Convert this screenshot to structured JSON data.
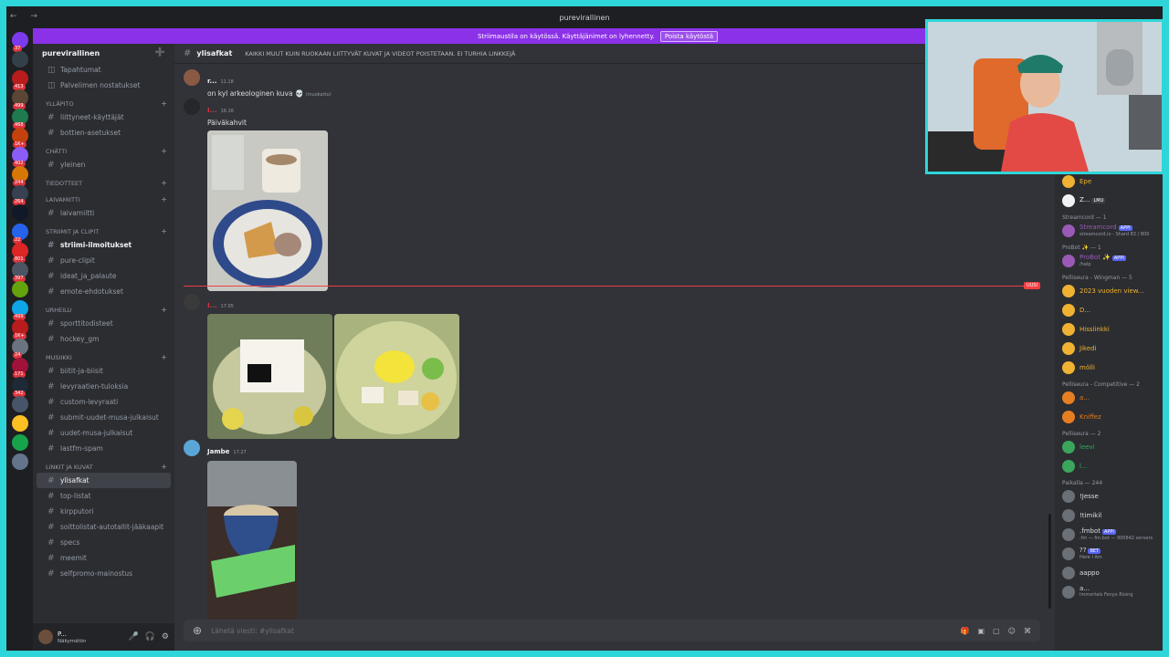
{
  "window": {
    "title": "purevirallinen",
    "nav": "← →"
  },
  "servers": [
    {
      "color": "#7c3aed",
      "badge": "37"
    },
    {
      "color": "#33404a",
      "badge": ""
    },
    {
      "color": "#b91c1c",
      "badge": "413"
    },
    {
      "color": "#5b4636",
      "badge": "499"
    },
    {
      "color": "#1f7a4d",
      "badge": "468"
    },
    {
      "color": "#c2410c",
      "badge": "1K+"
    },
    {
      "color": "#8b5cf6",
      "badge": "402"
    },
    {
      "color": "#d97706",
      "badge": "244"
    },
    {
      "color": "#374151",
      "badge": "264"
    },
    {
      "color": "#111827",
      "badge": ""
    },
    {
      "color": "#2563eb",
      "badge": "22"
    },
    {
      "color": "#dc2626",
      "badge": "801"
    },
    {
      "color": "#4b5563",
      "badge": "397"
    },
    {
      "color": "#65a30d",
      "badge": ""
    },
    {
      "color": "#0ea5e9",
      "badge": "499"
    },
    {
      "color": "#b91c1c",
      "badge": "1K+"
    },
    {
      "color": "#6b7280",
      "badge": "24"
    },
    {
      "color": "#9f1239",
      "badge": "171"
    },
    {
      "color": "#1f2937",
      "badge": "342"
    },
    {
      "color": "#475569",
      "badge": ""
    },
    {
      "color": "#fbbf24",
      "badge": ""
    },
    {
      "color": "#16a34a",
      "badge": ""
    },
    {
      "color": "#64748b",
      "badge": ""
    }
  ],
  "banner": {
    "text": "Striimaustila on käytössä. Käyttäjänimet on lyhennetty.",
    "button": "Poista käytöstä"
  },
  "sidebar": {
    "server_name": "purevirallinen",
    "top_items": [
      {
        "label": "Tapahtumat"
      },
      {
        "label": "Palvelimen nostatukset"
      }
    ],
    "categories": [
      {
        "name": "YLLÄPITO",
        "channels": [
          "liittyneet-käyttäjät",
          "bottien-asetukset"
        ]
      },
      {
        "name": "CHÄTTI",
        "channels": [
          "yleinen"
        ]
      },
      {
        "name": "TIEDOTTEET",
        "channels": []
      },
      {
        "name": "LAIVAMIITTI",
        "channels": [
          "laivamiitti"
        ]
      },
      {
        "name": "STRIIMIT JA CLIPIT",
        "channels": [
          "striimi-ilmoitukset",
          "pure-clipit",
          "ideat_ja_palaute",
          "emote-ehdotukset"
        ]
      },
      {
        "name": "urheilu",
        "channels": [
          "sporttitodisteet",
          "hockey_gm"
        ]
      },
      {
        "name": "MUSIIKKI",
        "channels": [
          "biitit-ja-biisit",
          "levyraatien-tuloksia",
          "custom-levyraati",
          "submit-uudet-musa-julkaisut",
          "uudet-musa-julkaisut",
          "lastfm-spam"
        ]
      },
      {
        "name": "LINKIT JA KUVAT",
        "channels": [
          "ylisafkat",
          "top-listat",
          "kirpputori",
          "soittolistat-autotallit-jääkaapit",
          "specs",
          "meemit",
          "selfpromo-mainostus"
        ]
      }
    ],
    "active_channel": "ylisafkat",
    "unread_channel": "striimi-ilmoitukset",
    "user": {
      "name": "P...",
      "status": "Näkymätön"
    }
  },
  "channel": {
    "name": "ylisafkat",
    "topic": "KAIKKI MUUT KUIN RUOKAAN LIITTYVÄT KUVAT JA VIDEOT POISTETAAN. EI TURHIA LINKKEJÄ",
    "composer_placeholder": "Lähetä viesti: #ylisafkat"
  },
  "messages": [
    {
      "author": "r...",
      "time": "11.18",
      "text": "on kyl arkeologinen kuva 💀",
      "edited": "(muokattu)",
      "avatar": "#8a5a44"
    },
    {
      "author": "I...",
      "time": "16.16",
      "text": "Päiväkahvit",
      "avatar": "#2b2d31"
    },
    {
      "author": "I...",
      "time": "17.05",
      "text": "",
      "avatar": "#3a3a3a"
    },
    {
      "author": "Jambe",
      "time": "17.27",
      "text": "",
      "avatar": "#5aa6d6"
    }
  ],
  "new_divider": "UUSI",
  "members": {
    "top": [
      {
        "name": "Epe",
        "color": "#f0b232"
      },
      {
        "name": "Z...",
        "color": "#f2f3f5",
        "extra": "LMU"
      }
    ],
    "groups": [
      {
        "title": "Streamcord — 1",
        "items": [
          {
            "name": "Streamcord",
            "sub": "streamcord.io - Shard 83 / 800",
            "color": "#9b59b6",
            "tag": "APPI"
          }
        ]
      },
      {
        "title": "ProBot ✨ — 1",
        "items": [
          {
            "name": "ProBot ✨",
            "sub": "/help",
            "color": "#9b59b6",
            "tag": "APPI"
          }
        ]
      },
      {
        "title": "Pelliseura - Wingman — 5",
        "items": [
          {
            "name": "2023 vuoden view...",
            "color": "#f0b232"
          },
          {
            "name": "D...",
            "color": "#f0b232"
          },
          {
            "name": "Hissiinkki",
            "color": "#f0b232"
          },
          {
            "name": "Jikedi",
            "color": "#f0b232"
          },
          {
            "name": "mölli",
            "color": "#f0b232"
          }
        ]
      },
      {
        "title": "Pelliseura - Competitive — 2",
        "items": [
          {
            "name": "a...",
            "color": "#e67e22"
          },
          {
            "name": "Kniffez",
            "color": "#e67e22"
          }
        ]
      },
      {
        "title": "Pelliseura — 2",
        "items": [
          {
            "name": "leevi",
            "color": "#3ba55c"
          },
          {
            "name": "l...",
            "color": "#3ba55c"
          }
        ]
      },
      {
        "title": "Paikalla — 244",
        "items": [
          {
            "name": "!Jesse",
            "color": "#dbdee1"
          },
          {
            "name": "!timikil",
            "color": "#dbdee1"
          },
          {
            "name": ".fmbot",
            "sub": ".fm — fm.bot — 995842 servers",
            "color": "#dbdee1",
            "tag": "APPI"
          },
          {
            "name": "??",
            "sub": "Here I Am",
            "color": "#dbdee1",
            "tag": "BET"
          },
          {
            "name": "aappo",
            "color": "#dbdee1"
          },
          {
            "name": "a...",
            "sub": "Immortals Fenyx Rising",
            "color": "#dbdee1"
          }
        ]
      }
    ]
  }
}
